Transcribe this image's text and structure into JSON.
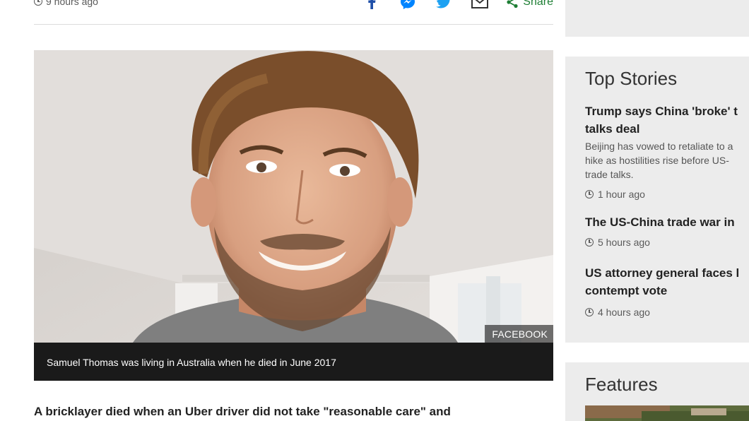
{
  "article": {
    "timestamp": "9 hours ago",
    "share_label": "Share",
    "image_credit": "FACEBOOK",
    "caption": "Samuel Thomas was living in Australia when he died in June 2017",
    "lede": "A bricklayer died when an Uber driver did not take \"reasonable care\" and"
  },
  "share_icons": [
    "facebook-icon",
    "messenger-icon",
    "twitter-icon",
    "email-icon",
    "share-icon"
  ],
  "colors": {
    "share_green": "#1e7e34",
    "caption_bg": "#1a1a1a",
    "sidebar_bg": "#ececec"
  },
  "sidebar": {
    "top_panel_text": "",
    "top_stories": {
      "heading": "Top Stories",
      "items": [
        {
          "title_line1": "Trump says China 'broke' t",
          "title_line2": "talks deal",
          "summary_line1": "Beijing has vowed to retaliate to a",
          "summary_line2": "hike as hostilities rise before US-",
          "summary_line3": "trade talks.",
          "time": "1 hour ago"
        },
        {
          "title_line1": "The US-China trade war in",
          "time": "5 hours ago"
        },
        {
          "title_line1": "US attorney general faces l",
          "title_line2": "contempt vote",
          "time": "4 hours ago"
        }
      ]
    },
    "features": {
      "heading": "Features"
    }
  }
}
